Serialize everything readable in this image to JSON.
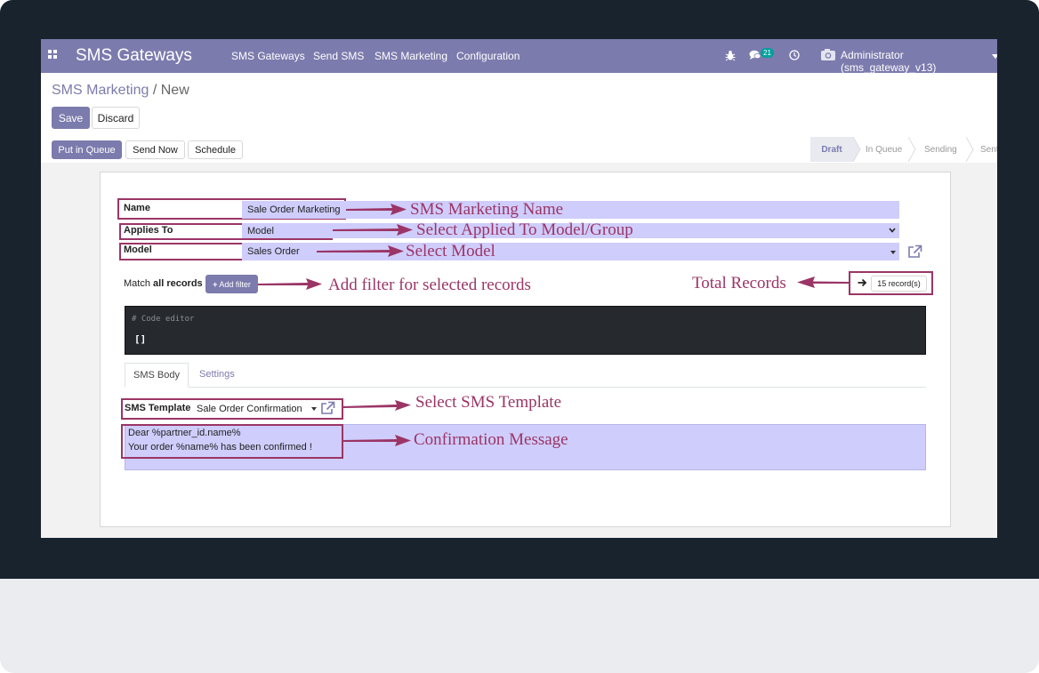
{
  "navbar": {
    "brand": "SMS Gateways",
    "menu": [
      "SMS Gateways",
      "Send SMS",
      "SMS Marketing",
      "Configuration"
    ],
    "message_count": "21",
    "user": "Administrator (sms_gateway_v13)"
  },
  "breadcrumb": {
    "parent": "SMS Marketing",
    "separator": "/",
    "current": "New"
  },
  "actions": {
    "save": "Save",
    "discard": "Discard"
  },
  "header_buttons": {
    "queue": "Put in Queue",
    "send_now": "Send Now",
    "schedule": "Schedule"
  },
  "stages": [
    "Draft",
    "In Queue",
    "Sending",
    "Sent"
  ],
  "active_stage": "Draft",
  "form": {
    "name_label": "Name",
    "name_value": "Sale Order Marketing",
    "applies_label": "Applies To",
    "applies_value": "Model",
    "model_label": "Model",
    "model_value": "Sales Order",
    "match_prefix": "Match",
    "match_bold": "all records",
    "add_filter": "Add filter",
    "record_count": "15 record(s)",
    "code_comment": "# Code editor",
    "code_value": "[]"
  },
  "tabs": [
    "SMS Body",
    "Settings"
  ],
  "body": {
    "template_label": "SMS Template",
    "template_value": "Sale Order Confirmation",
    "message_line1": "Dear %partner_id.name%",
    "message_line2": "Your order %name% has been confirmed !"
  },
  "annotations": {
    "name": "SMS Marketing Name",
    "applies": "Select Applied To Model/Group",
    "model": "Select Model",
    "filter": "Add filter for selected records",
    "total": "Total Records",
    "template": "Select SMS Template",
    "message": "Confirmation Message"
  },
  "colors": {
    "brand": "#7c7bad",
    "field_highlight": "#cfcdfb",
    "annotation": "#9b3566",
    "bezel": "#18232e"
  }
}
